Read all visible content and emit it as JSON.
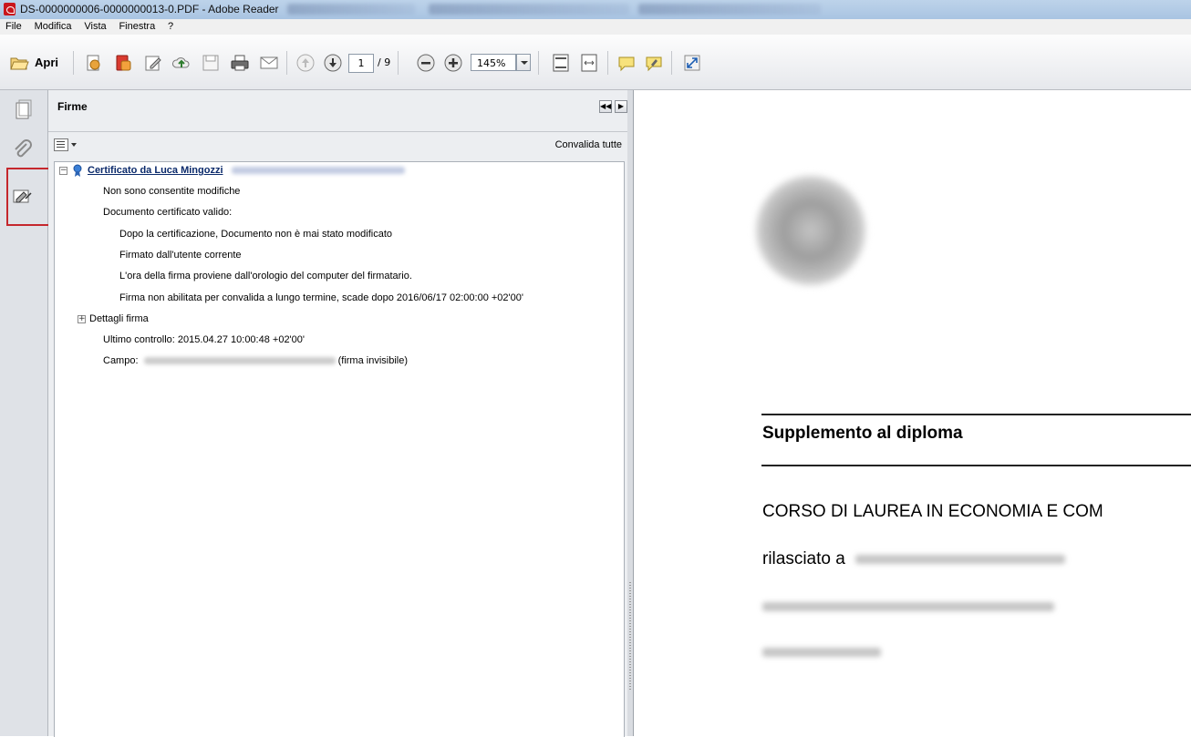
{
  "window": {
    "title": "DS-0000000006-0000000013-0.PDF - Adobe Reader"
  },
  "menu": [
    "File",
    "Modifica",
    "Vista",
    "Finestra",
    "?"
  ],
  "toolbar": {
    "open_label": "Apri",
    "current_page": "1",
    "page_total": "/ 9",
    "zoom": "145%"
  },
  "signatures_panel": {
    "title": "Firme",
    "validate_all": "Convalida tutte",
    "certificate_title": "Certificato da Luca Mingozzi",
    "lines": {
      "no_changes": "Non sono consentite modifiche",
      "doc_certified_valid": "Documento certificato valido:",
      "not_modified": "Dopo la certificazione, Documento non è mai stato modificato",
      "signed_by_current_user": "Firmato dall'utente corrente",
      "time_source": "L'ora della firma proviene dall'orologio del computer del firmatario.",
      "ltv": "Firma non abilitata per convalida a lungo termine, scade dopo 2016/06/17 02:00:00 +02'00'",
      "details": "Dettagli firma",
      "last_check": "Ultimo controllo: 2015.04.27 10:00:48 +02'00'",
      "field_label": "Campo:",
      "field_suffix": "(firma invisibile)"
    }
  },
  "document": {
    "heading": "Supplemento al diploma",
    "course": "CORSO DI LAUREA IN ECONOMIA E COM",
    "issued_to_label": "rilasciato a"
  },
  "colors": {
    "highlight_box": "#c5272d",
    "certificate_link": "#0b2a6b"
  }
}
